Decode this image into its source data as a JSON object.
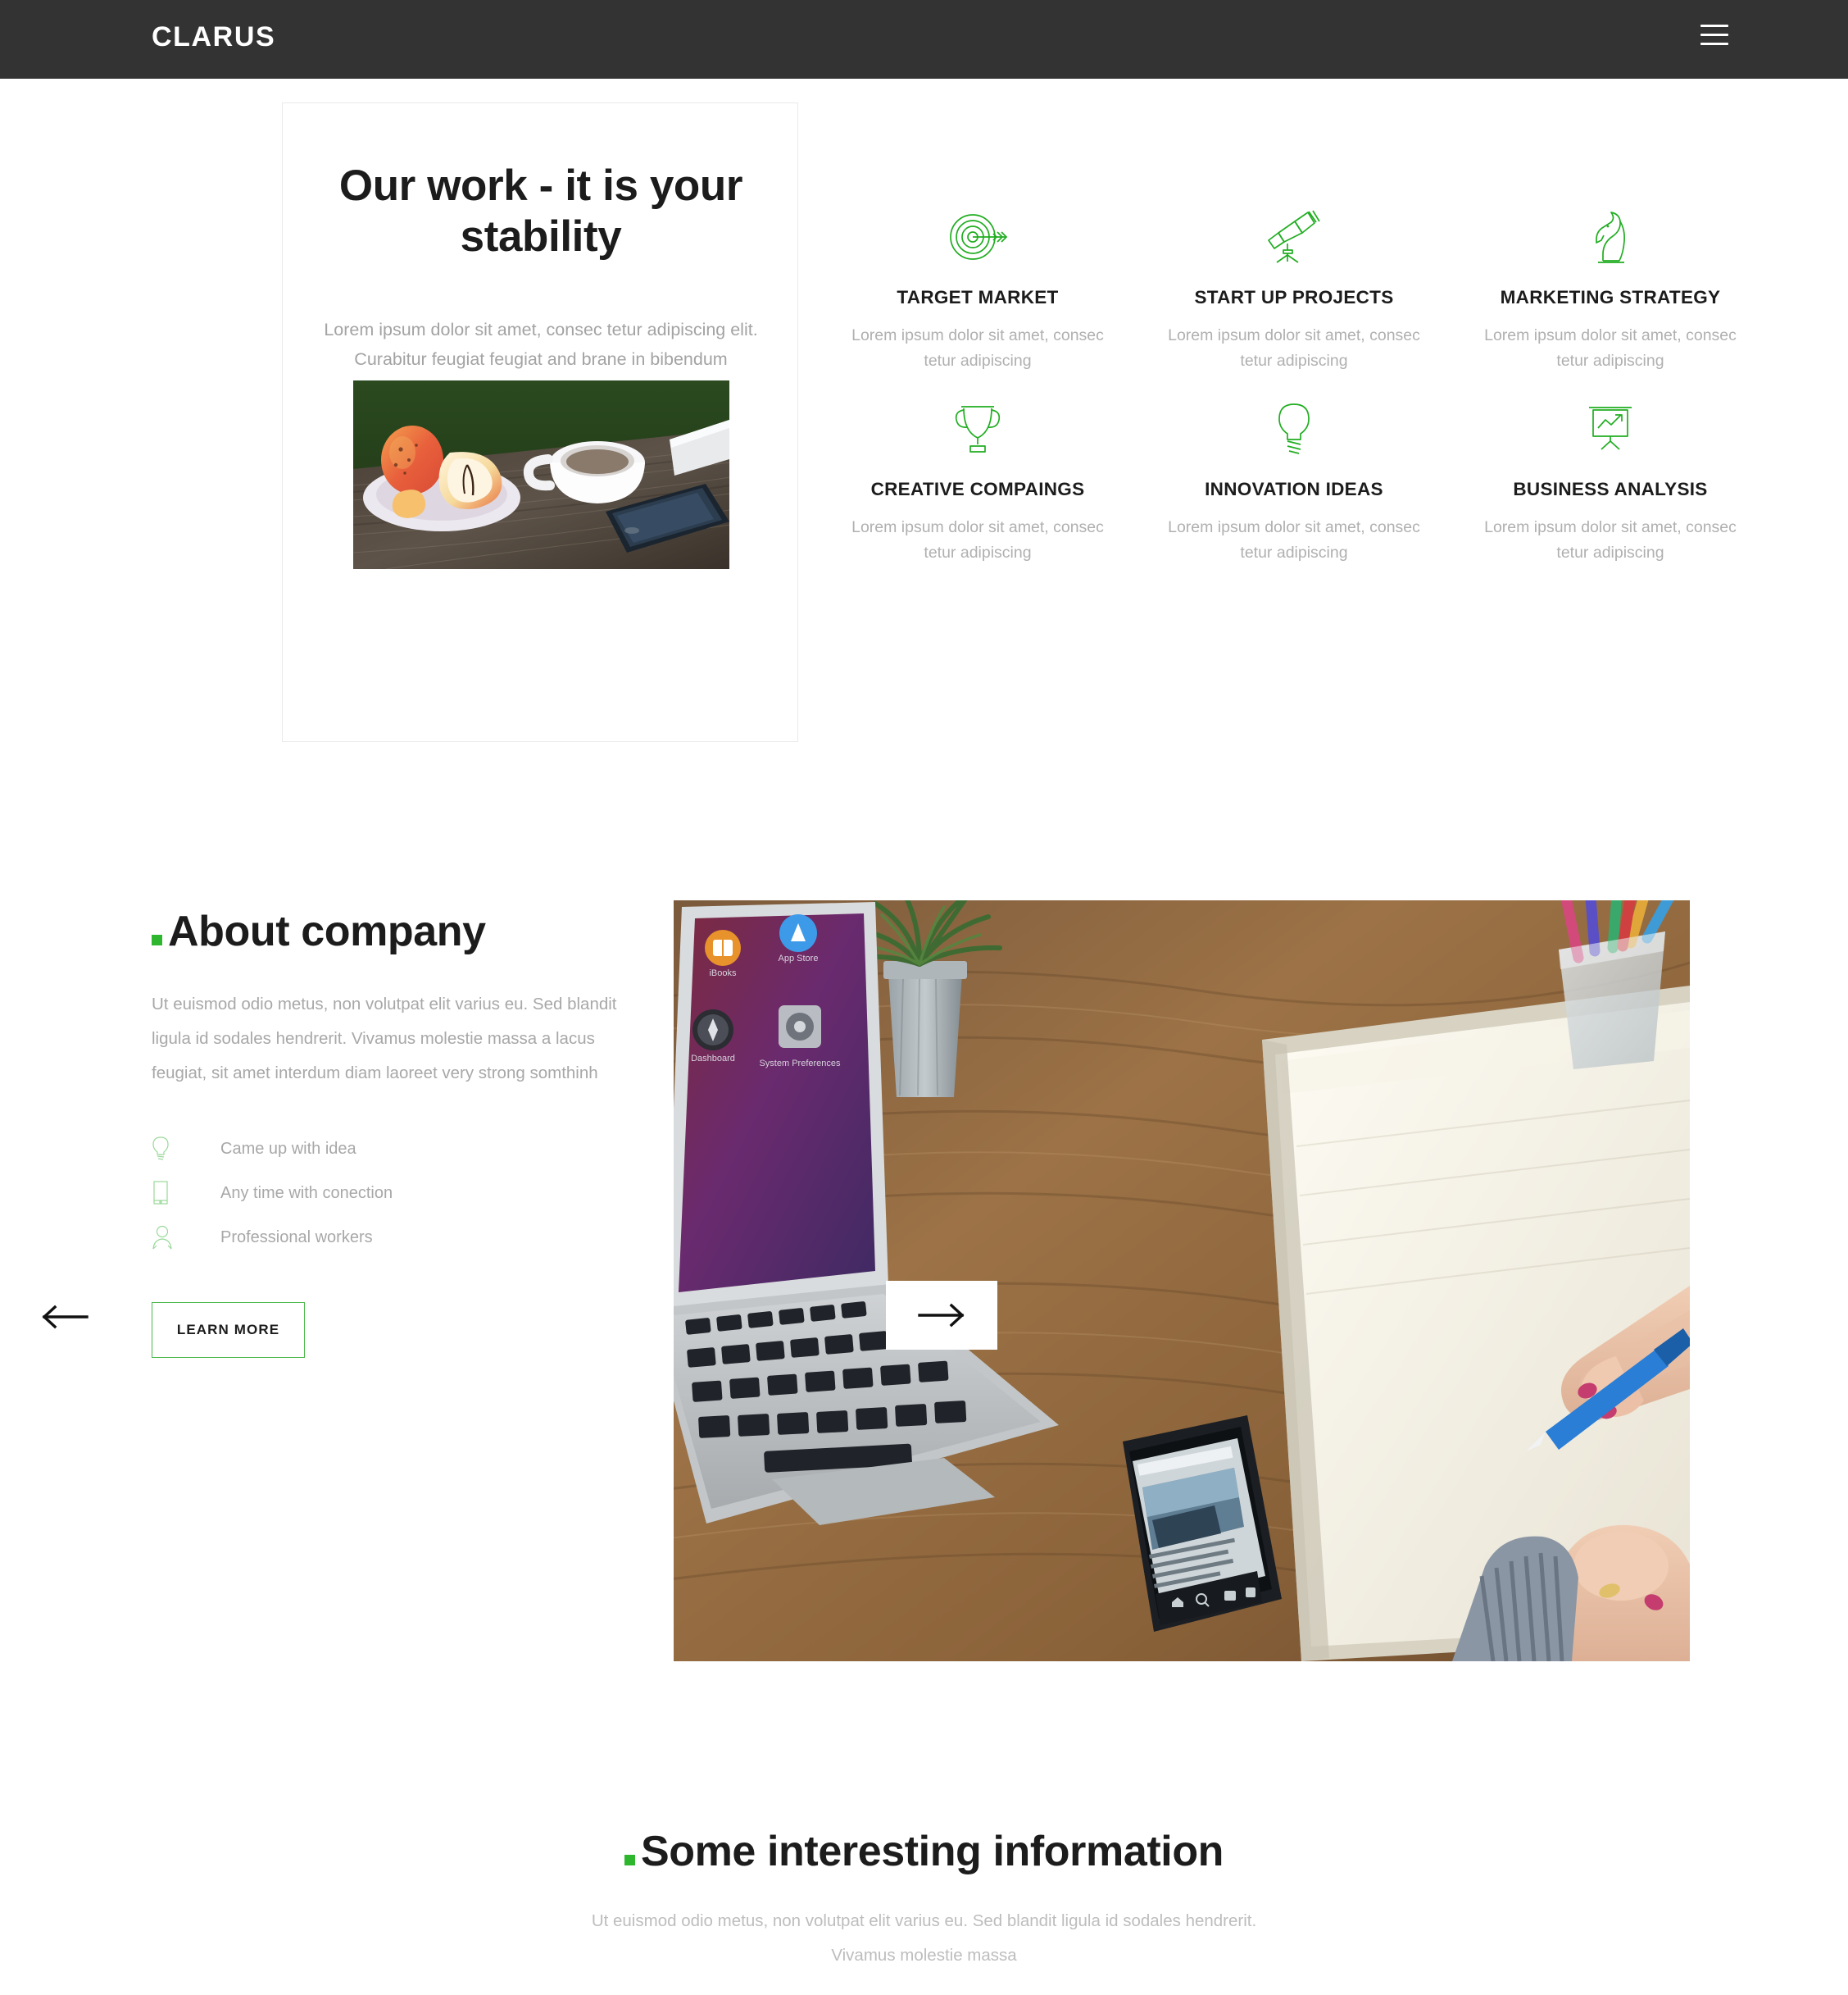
{
  "theme": {
    "accent_green": "#2fb62f",
    "header_bg": "#333333",
    "text_dark": "#1c1c1c",
    "text_muted": "#a8a8a8"
  },
  "ghost_text": "sodales hendrerit. Vivamus molestie massa",
  "header": {
    "brand": "CLARUS",
    "menu_icon": "hamburger-icon"
  },
  "hero": {
    "title": "Our work - it is your stability",
    "subtitle": "Lorem ipsum dolor sit amet, consec tetur adipiscing elit. Curabitur feugiat feugiat and brane in bibendum",
    "photo_alt": "apples-coffee-phone-on-wooden-table"
  },
  "features": [
    {
      "icon": "target-icon",
      "title": "TARGET MARKET",
      "desc": "Lorem ipsum dolor sit amet, consec tetur adipiscing"
    },
    {
      "icon": "telescope-icon",
      "title": "START UP PROJECTS",
      "desc": "Lorem ipsum dolor sit amet, consec tetur adipiscing"
    },
    {
      "icon": "chess-knight-icon",
      "title": "MARKETING STRATEGY",
      "desc": "Lorem ipsum dolor sit amet, consec tetur adipiscing"
    },
    {
      "icon": "trophy-icon",
      "title": "CREATIVE COMPAINGS",
      "desc": "Lorem ipsum dolor sit amet, consec tetur adipiscing"
    },
    {
      "icon": "lightbulb-icon",
      "title": "INNOVATION IDEAS",
      "desc": "Lorem ipsum dolor sit amet, consec tetur adipiscing"
    },
    {
      "icon": "presentation-chart-icon",
      "title": "BUSINESS ANALYSIS",
      "desc": "Lorem ipsum dolor sit amet, consec tetur adipiscing"
    }
  ],
  "about": {
    "heading": "About company",
    "body": "Ut euismod odio metus, non volutpat elit varius eu. Sed blandit ligula id sodales hendrerit. Vivamus molestie massa a lacus feugiat, sit amet interdum diam laoreet very strong somthinh",
    "list": [
      {
        "icon": "lightbulb-icon",
        "label": "Came up with idea"
      },
      {
        "icon": "tablet-icon",
        "label": "Any time with conection"
      },
      {
        "icon": "person-icon",
        "label": "Professional workers"
      }
    ],
    "cta_label": "LEARN MORE",
    "image_alt": "laptop-phone-notebook-hands-writing-on-desk",
    "prev_icon": "arrow-left-icon",
    "next_icon": "arrow-right-icon"
  },
  "info": {
    "heading": "Some interesting information",
    "subtitle": "Ut euismod odio metus, non volutpat elit varius eu. Sed blandit ligula id sodales hendrerit. Vivamus molestie massa"
  }
}
